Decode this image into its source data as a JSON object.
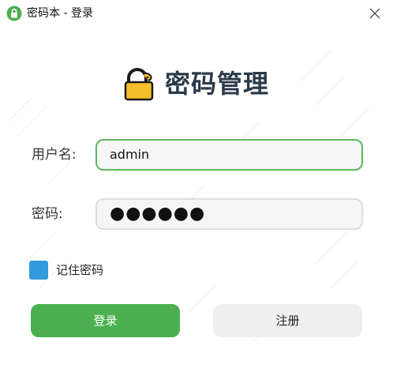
{
  "window": {
    "title": "密码本 - 登录",
    "icon": "lock-icon",
    "close_icon": "close-icon"
  },
  "header": {
    "logo_icon": "padlock-icon",
    "title": "密码管理"
  },
  "form": {
    "username_label": "用户名:",
    "username_value": "admin",
    "password_label": "密码:",
    "password_display": "●●●●●●",
    "remember_label": "记住密码",
    "remember_checked": true
  },
  "buttons": {
    "login_label": "登录",
    "register_label": "注册"
  },
  "colors": {
    "primary": "#4caf50",
    "accent_checkbox": "#3399dd",
    "focus_border": "#5cb85c",
    "title_text": "#2b3a4a",
    "logo_yellow": "#f5bf2a"
  }
}
